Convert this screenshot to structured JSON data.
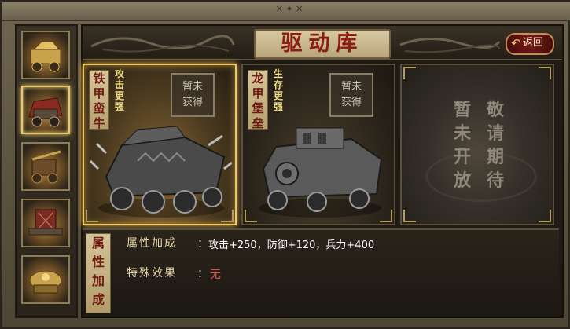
{
  "window": {
    "top_deco": "✕ ✦ ✕"
  },
  "header": {
    "title": "驱动库",
    "back_label": "返回"
  },
  "sidebar": {
    "items": [
      {
        "name": "vehicle-thumb-1",
        "selected": false
      },
      {
        "name": "vehicle-thumb-2",
        "selected": true
      },
      {
        "name": "vehicle-thumb-3",
        "selected": false
      },
      {
        "name": "vehicle-thumb-4",
        "selected": false
      },
      {
        "name": "vehicle-thumb-5",
        "selected": false
      }
    ]
  },
  "cards": [
    {
      "name_chars": [
        "铁",
        "甲",
        "蛮",
        "牛"
      ],
      "tag_chars": [
        "攻",
        "击",
        "更",
        "强"
      ],
      "status_chars": [
        "暂未",
        "获得"
      ],
      "selected": true
    },
    {
      "name_chars": [
        "龙",
        "甲",
        "堡",
        "垒"
      ],
      "tag_chars": [
        "生",
        "存",
        "更",
        "强"
      ],
      "status_chars": [
        "暂未",
        "获得"
      ],
      "selected": false
    }
  ],
  "closed_panel": {
    "col1": [
      "暂",
      "未",
      "开",
      "放"
    ],
    "col2": [
      "敬",
      "请",
      "期",
      "待"
    ]
  },
  "info": {
    "label_chars": [
      "属",
      "性",
      "加",
      "成"
    ],
    "attr_key": "属性加成",
    "attr_value": "攻击+250，防御+120，兵力+400",
    "effect_key": "特殊效果",
    "effect_value": "无",
    "colon": "："
  },
  "colors": {
    "accent_gold": "#f0c760",
    "title_red": "#8c1d14",
    "none_red": "#e0534a"
  }
}
